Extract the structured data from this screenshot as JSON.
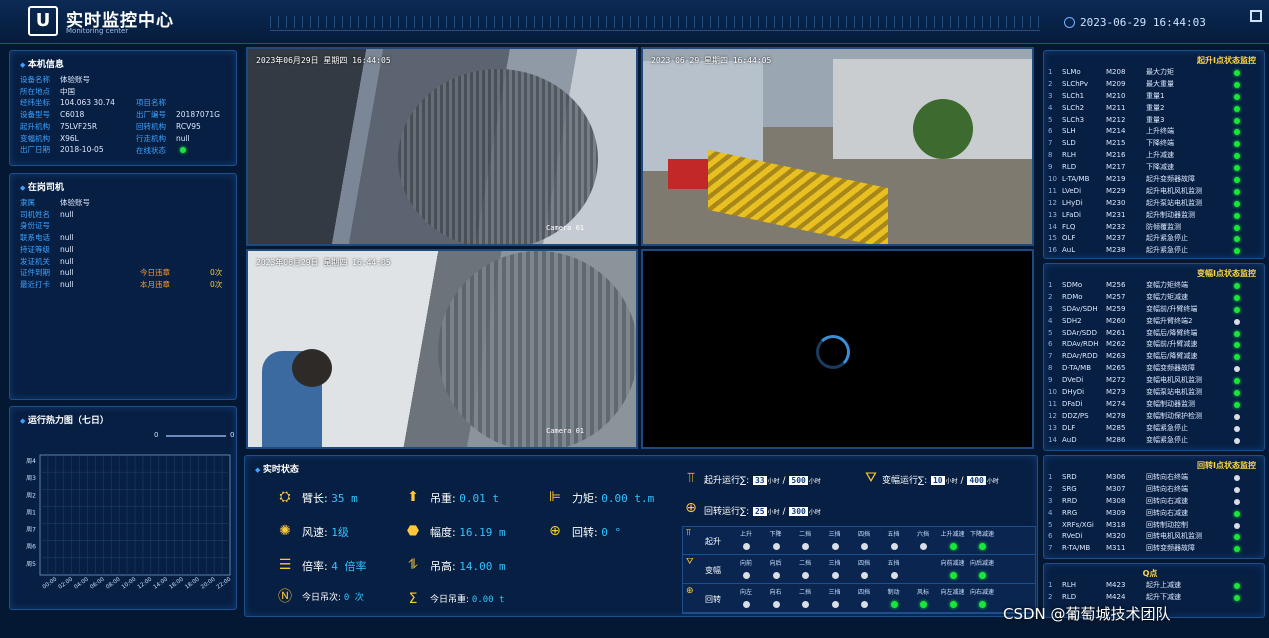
{
  "header": {
    "logo": "U",
    "title": "实时监控中心",
    "subtitle": "Monitoring center",
    "datetime": "2023-06-29 16:44:03"
  },
  "machine_info": {
    "title": "本机信息",
    "rows": [
      {
        "k": "设备名称",
        "v": "体验账号"
      },
      {
        "k": "所在地点",
        "v": "中国"
      },
      {
        "k": "经纬坐标",
        "v": "104.063   30.74",
        "k2": "项目名称",
        "v2": ""
      },
      {
        "k": "设备型号",
        "v": "C6018",
        "k2": "出厂编号",
        "v2": "20187071G"
      },
      {
        "k": "起升机构",
        "v": "75LVF25R",
        "k2": "回转机构",
        "v2": "RCV95"
      },
      {
        "k": "变幅机构",
        "v": "X96L",
        "k2": "行走机构",
        "v2": "null"
      },
      {
        "k": "出厂日期",
        "v": "2018-10-05",
        "k2": "在线状态",
        "v2": ""
      }
    ]
  },
  "driver_info": {
    "title": "在岗司机",
    "rows": [
      {
        "k": "隶属",
        "v": "体验账号"
      },
      {
        "k": "司机姓名",
        "v": "null"
      },
      {
        "k": "身份证号",
        "v": ""
      },
      {
        "k": "联系电话",
        "v": "null"
      },
      {
        "k": "持证等级",
        "v": "null"
      },
      {
        "k": "发证机关",
        "v": "null"
      },
      {
        "k": "证件到期",
        "v": "null",
        "k2": "今日违章",
        "v2": "0次"
      },
      {
        "k": "最近打卡",
        "v": "null",
        "k2": "本月违章",
        "v2": "0次"
      }
    ]
  },
  "heatmap": {
    "title": "运行热力图（七日）",
    "scale_min": "0",
    "scale_max": "0"
  },
  "chart_data": {
    "type": "heatmap",
    "title": "运行热力图（七日）",
    "y_categories": [
      "周4",
      "周3",
      "周2",
      "周1",
      "周7",
      "周6",
      "周5"
    ],
    "x_categories": [
      "00:00",
      "02:00",
      "04:00",
      "06:00",
      "08:00",
      "10:00",
      "12:00",
      "14:00",
      "16:00",
      "18:00",
      "20:00",
      "22:00"
    ],
    "values": [],
    "scale": [
      0,
      0
    ]
  },
  "cameras": [
    {
      "timestamp": "2023年06月29日  星期四   16:44:05",
      "label": "Camera 01"
    },
    {
      "timestamp": "2023-06-29   星期四   16:44:05",
      "label": ""
    },
    {
      "timestamp": "2023年06月29日  星期四   16:44:05",
      "label": "Camera 01"
    }
  ],
  "realtime": {
    "title": "实时状态",
    "metrics": [
      {
        "label": "臂长:",
        "value": "35 m"
      },
      {
        "label": "吊重:",
        "value": "0.01 t"
      },
      {
        "label": "力矩:",
        "value": "0.00 t.m"
      },
      {
        "label": "风速:",
        "value": "1级"
      },
      {
        "label": "幅度:",
        "value": "16.19 m"
      },
      {
        "label": "回转:",
        "value": "0 °"
      },
      {
        "label": "倍率:",
        "value": "4 倍率"
      },
      {
        "label": "吊高:",
        "value": "14.00 m"
      },
      {
        "label": "今日吊次:",
        "value": "0 次"
      },
      {
        "label": "今日吊重:",
        "value": "0.00 t"
      }
    ],
    "lift_run": {
      "label": "起升运行∑:",
      "a": "33",
      "unit_a": "小时",
      "b": "500",
      "unit_b": "小时"
    },
    "luff_run": {
      "label": "变幅运行∑:",
      "a": "10",
      "unit_a": "小时",
      "b": "400",
      "unit_b": "小时"
    },
    "slew_run": {
      "label": "回转运行∑:",
      "a": "25",
      "unit_a": "小时",
      "b": "300",
      "unit_b": "小时"
    }
  },
  "gear_grid": {
    "rows": [
      {
        "name": "起升",
        "cols": [
          "上升",
          "下降",
          "二挡",
          "三挡",
          "四挡",
          "五挡",
          "六挡",
          "上升减速",
          "下降减速"
        ],
        "states": [
          "off",
          "off",
          "off",
          "off",
          "off",
          "off",
          "off",
          "on",
          "on"
        ]
      },
      {
        "name": "变幅",
        "cols": [
          "向前",
          "向后",
          "二挡",
          "三挡",
          "四挡",
          "五挡",
          "",
          "向前减速",
          "向后减速"
        ],
        "states": [
          "off",
          "off",
          "off",
          "off",
          "off",
          "off",
          "none",
          "on",
          "on"
        ]
      },
      {
        "name": "回转",
        "cols": [
          "向左",
          "向右",
          "二挡",
          "三挡",
          "四挡",
          "制动",
          "风标",
          "向左减速",
          "向右减速"
        ],
        "states": [
          "off",
          "off",
          "off",
          "off",
          "off",
          "on",
          "on",
          "on",
          "on"
        ]
      }
    ]
  },
  "lift_monitor": {
    "title": "起升Ⅰ点状态监控",
    "rows": [
      {
        "n": "1",
        "a": "SLMo",
        "b": "M208",
        "c": "最大力矩",
        "s": "on"
      },
      {
        "n": "2",
        "a": "SLChPv",
        "b": "M209",
        "c": "最大重量",
        "s": "on"
      },
      {
        "n": "3",
        "a": "SLCh1",
        "b": "M210",
        "c": "重量1",
        "s": "on"
      },
      {
        "n": "4",
        "a": "SLCh2",
        "b": "M211",
        "c": "重量2",
        "s": "on"
      },
      {
        "n": "5",
        "a": "SLCh3",
        "b": "M212",
        "c": "重量3",
        "s": "on"
      },
      {
        "n": "6",
        "a": "SLH",
        "b": "M214",
        "c": "上升终端",
        "s": "on"
      },
      {
        "n": "7",
        "a": "SLD",
        "b": "M215",
        "c": "下降终端",
        "s": "on"
      },
      {
        "n": "8",
        "a": "RLH",
        "b": "M216",
        "c": "上升减速",
        "s": "on"
      },
      {
        "n": "9",
        "a": "RLD",
        "b": "M217",
        "c": "下降减速",
        "s": "on"
      },
      {
        "n": "10",
        "a": "L-TA/MB",
        "b": "M219",
        "c": "起升变频器故障",
        "s": "on"
      },
      {
        "n": "11",
        "a": "LVeDi",
        "b": "M229",
        "c": "起升电机风机监测",
        "s": "on"
      },
      {
        "n": "12",
        "a": "LHyDi",
        "b": "M230",
        "c": "起升泵站电机监测",
        "s": "on"
      },
      {
        "n": "13",
        "a": "LFaDi",
        "b": "M231",
        "c": "起升制动器监测",
        "s": "on"
      },
      {
        "n": "14",
        "a": "FLQ",
        "b": "M232",
        "c": "防倾覆监测",
        "s": "on"
      },
      {
        "n": "15",
        "a": "OLF",
        "b": "M237",
        "c": "起升紧急停止",
        "s": "on"
      },
      {
        "n": "16",
        "a": "AuL",
        "b": "M238",
        "c": "起升紧急停止",
        "s": "on"
      }
    ]
  },
  "luff_monitor": {
    "title": "变幅Ⅰ点状态监控",
    "rows": [
      {
        "n": "1",
        "a": "SDMo",
        "b": "M256",
        "c": "变幅力矩终端",
        "s": "on"
      },
      {
        "n": "2",
        "a": "RDMo",
        "b": "M257",
        "c": "变幅力矩减速",
        "s": "on"
      },
      {
        "n": "3",
        "a": "SDAv/SDH",
        "b": "M259",
        "c": "变幅前/升臂终端",
        "s": "on"
      },
      {
        "n": "4",
        "a": "SDH2",
        "b": "M260",
        "c": "变幅升臂终端2",
        "s": "off"
      },
      {
        "n": "5",
        "a": "SDAr/SDD",
        "b": "M261",
        "c": "变幅后/降臂终端",
        "s": "on"
      },
      {
        "n": "6",
        "a": "RDAv/RDH",
        "b": "M262",
        "c": "变幅前/升臂减速",
        "s": "on"
      },
      {
        "n": "7",
        "a": "RDAr/RDD",
        "b": "M263",
        "c": "变幅后/降臂减速",
        "s": "on"
      },
      {
        "n": "8",
        "a": "D-TA/MB",
        "b": "M265",
        "c": "变幅变频器故障",
        "s": "off"
      },
      {
        "n": "9",
        "a": "DVeDi",
        "b": "M272",
        "c": "变幅电机风机监测",
        "s": "on"
      },
      {
        "n": "10",
        "a": "DHyDi",
        "b": "M273",
        "c": "变幅泵站电机监测",
        "s": "on"
      },
      {
        "n": "11",
        "a": "DFaDi",
        "b": "M274",
        "c": "变幅制动器监测",
        "s": "on"
      },
      {
        "n": "12",
        "a": "DDZ/PS",
        "b": "M278",
        "c": "变幅制动保护检测",
        "s": "off"
      },
      {
        "n": "13",
        "a": "DLF",
        "b": "M285",
        "c": "变幅紧急停止",
        "s": "off"
      },
      {
        "n": "14",
        "a": "AuD",
        "b": "M286",
        "c": "变幅紧急停止",
        "s": "off"
      }
    ]
  },
  "slew_monitor": {
    "title": "回转Ⅰ点状态监控",
    "rows": [
      {
        "n": "1",
        "a": "SRD",
        "b": "M306",
        "c": "回转向右终端",
        "s": "off"
      },
      {
        "n": "2",
        "a": "SRG",
        "b": "M307",
        "c": "回转向右终端",
        "s": "off"
      },
      {
        "n": "3",
        "a": "RRD",
        "b": "M308",
        "c": "回转向右减速",
        "s": "off"
      },
      {
        "n": "4",
        "a": "RRG",
        "b": "M309",
        "c": "回转向右减速",
        "s": "on"
      },
      {
        "n": "5",
        "a": "XRFs/XGi",
        "b": "M318",
        "c": "回转制动控制",
        "s": "off"
      },
      {
        "n": "6",
        "a": "RVeDi",
        "b": "M320",
        "c": "回转电机风机监测",
        "s": "on"
      },
      {
        "n": "7",
        "a": "R-TA/MB",
        "b": "M311",
        "c": "回转变频器故障",
        "s": "on"
      }
    ]
  },
  "q_monitor": {
    "title": "Q点",
    "rows": [
      {
        "n": "1",
        "a": "RLH",
        "b": "M423",
        "c": "起升上减速",
        "s": "on"
      },
      {
        "n": "2",
        "a": "RLD",
        "b": "M424",
        "c": "起升下减速",
        "s": "on"
      }
    ]
  },
  "watermark": "CSDN @葡萄城技术团队"
}
